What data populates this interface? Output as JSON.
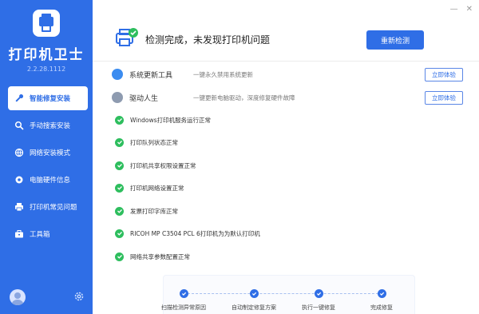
{
  "app": {
    "title": "打印机卫士",
    "version": "2.2.28.1112"
  },
  "sidebar": {
    "items": [
      {
        "label": "智能修复安装",
        "icon": "wrench-icon",
        "active": true
      },
      {
        "label": "手动搜索安装",
        "icon": "search-icon",
        "active": false
      },
      {
        "label": "网络安装模式",
        "icon": "network-icon",
        "active": false
      },
      {
        "label": "电脑硬件信息",
        "icon": "hardware-icon",
        "active": false
      },
      {
        "label": "打印机常见问题",
        "icon": "printer-icon",
        "active": false
      },
      {
        "label": "工具箱",
        "icon": "toolbox-icon",
        "active": false
      }
    ]
  },
  "window": {
    "minimize": "—",
    "close": "✕"
  },
  "header": {
    "status_text": "检测完成，未发现打印机问题",
    "rescan_label": "重新检测"
  },
  "tools": [
    {
      "name": "系统更新工具",
      "desc": "一键永久禁用系统更新",
      "button": "立即体验",
      "color": "#3b8cf0"
    },
    {
      "name": "驱动人生",
      "desc": "一键更新电脑驱动，深度修复硬件故障",
      "button": "立即体验",
      "color": "#8e9bb0"
    }
  ],
  "checks": [
    "Windows打印机服务运行正常",
    "打印队列状态正常",
    "打印机共享权限设置正常",
    "打印机网络设置正常",
    "发票打印字库正常",
    "RICOH MP C3504 PCL 6打印机为为默认打印机",
    "网络共享参数配置正常"
  ],
  "steps": [
    "扫描检测异常原因",
    "自动制定修复方案",
    "执行一键修复",
    "完成修复"
  ],
  "colors": {
    "accent": "#2f6ee6",
    "success": "#2ebe5e"
  }
}
